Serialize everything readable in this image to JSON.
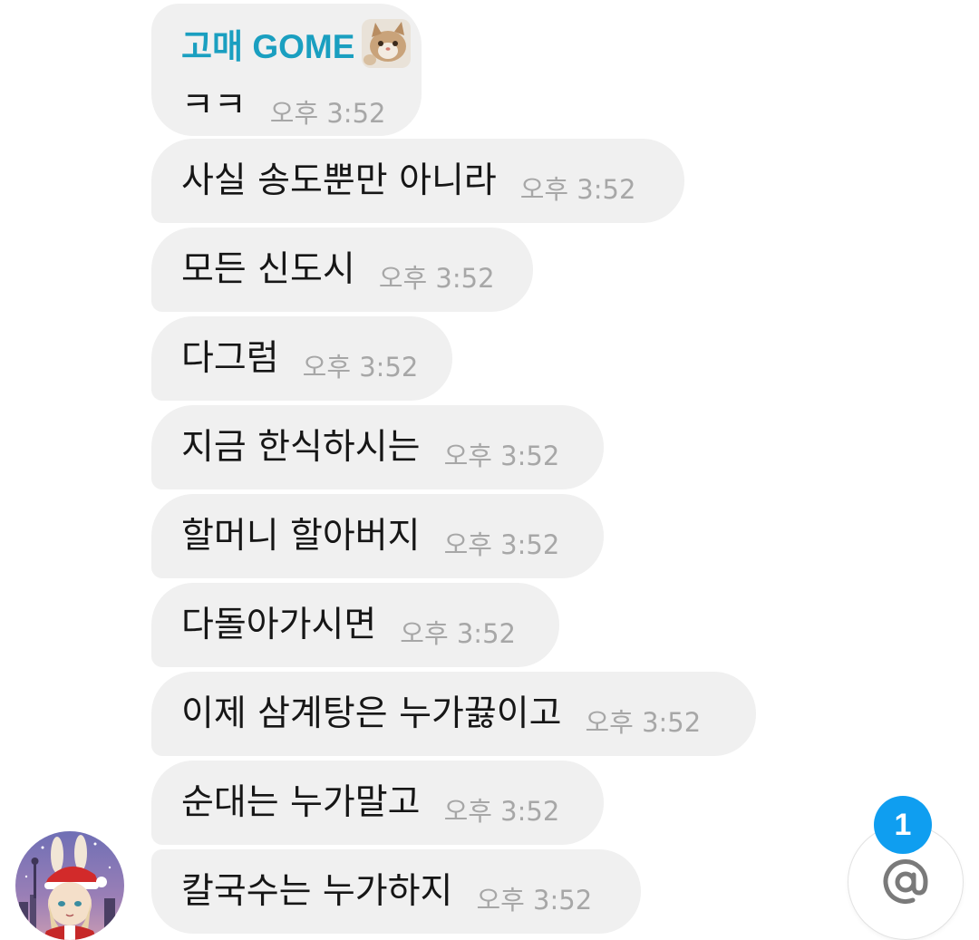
{
  "chat": {
    "sender": {
      "name": "고매 GOME",
      "badge_icon": "cat-sticker-icon",
      "avatar_icon": "bunny-santa-avatar-icon"
    },
    "messages": [
      {
        "text": "ㅋㅋ",
        "time": "오후 3:52"
      },
      {
        "text": "사실 송도뿐만 아니라",
        "time": "오후 3:52"
      },
      {
        "text": "모든 신도시",
        "time": "오후 3:52"
      },
      {
        "text": "다그럼",
        "time": "오후 3:52"
      },
      {
        "text": "지금 한식하시는",
        "time": "오후 3:52"
      },
      {
        "text": "할머니 할아버지",
        "time": "오후 3:52"
      },
      {
        "text": "다돌아가시면",
        "time": "오후 3:52"
      },
      {
        "text": "이제 삼계탕은 누가끓이고",
        "time": "오후 3:52"
      },
      {
        "text": "순대는 누가말고",
        "time": "오후 3:52"
      },
      {
        "text": "칼국수는 누가하지",
        "time": "오후 3:52"
      }
    ]
  },
  "mention": {
    "icon": "at-sign-icon",
    "count": "1",
    "badge_color": "#0f9ef0"
  }
}
